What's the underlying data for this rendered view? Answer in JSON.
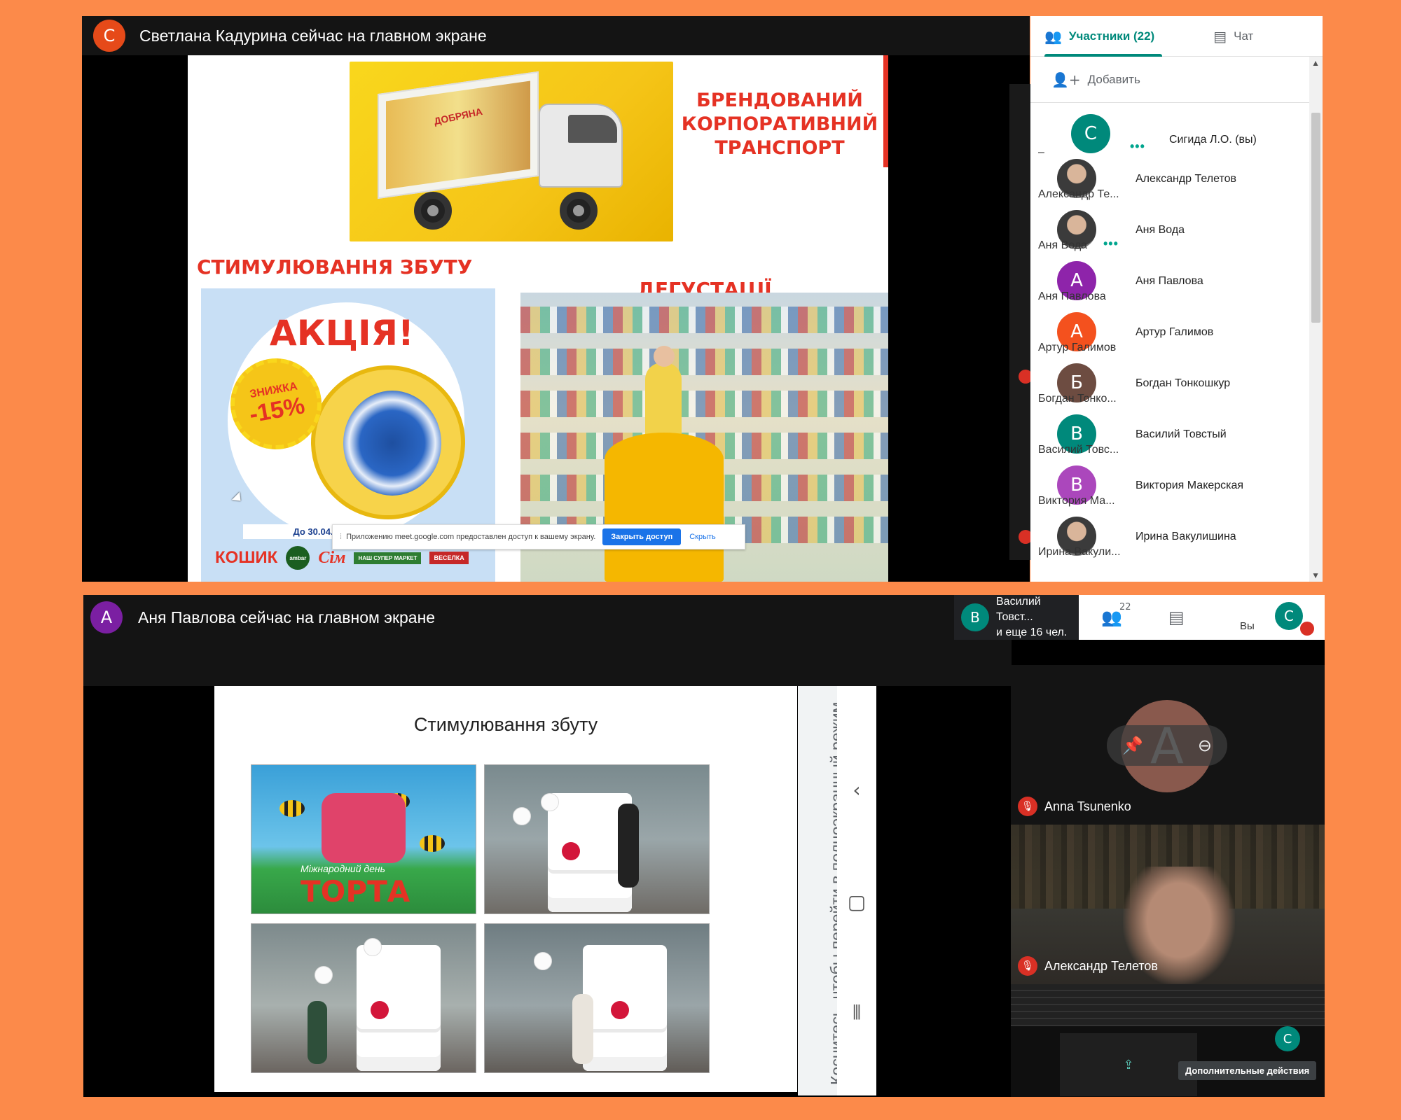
{
  "colors": {
    "page_bg": "#FC8A4A",
    "teal": "#00897B",
    "red": "#E53224",
    "mic_red": "#d93025",
    "link_blue": "#1a73e8"
  },
  "top": {
    "presenter_initial": "С",
    "presenter_color": "#E64A19",
    "banner": "Светлана Кадурина сейчас на главном экране",
    "slide": {
      "truck_logo": "ДОБРЯНА",
      "brand_title_1": "БРЕНДОВАНИЙ",
      "brand_title_2": "КОРПОРАТИВНИЙ",
      "brand_title_3": "ТРАНСПОРТ",
      "heading_promo": "СТИМУЛЮВАННЯ ЗБУТУ",
      "heading_tasting": "ДЕГУСТАЦІЇ",
      "promo_title": "АКЦІЯ!",
      "discount_label": "ЗНИЖКА",
      "discount_value": "-15%",
      "promo_until": "До 30.04.",
      "stores": [
        "КОШИК",
        "ambar",
        "Сім",
        "НАШ СУПЕР МАРКЕТ",
        "ВЕСЕЛКА"
      ]
    },
    "screen_share_notice": {
      "text": "Приложению meet.google.com предоставлен доступ к вашему экрану.",
      "stop_label": "Закрыть доступ",
      "hide_label": "Скрыть"
    }
  },
  "sidebar": {
    "tab_people": "Участники (22)",
    "tab_chat": "Чат",
    "add_label": "Добавить",
    "participants": [
      {
        "initial": "С",
        "color": "#00897B",
        "tile_label": "–",
        "name": "Сигида Л.О. (вы)",
        "photo": false,
        "dots": true
      },
      {
        "initial": "",
        "color": "",
        "tile_label": "Александр Те...",
        "name": "Александр Телетов",
        "photo": true,
        "dots": false
      },
      {
        "initial": "",
        "color": "",
        "tile_label": "Аня Вода",
        "name": "Аня Вода",
        "photo": true,
        "dots": true
      },
      {
        "initial": "А",
        "color": "#8E24AA",
        "tile_label": "Аня Павлова",
        "name": "Аня Павлова",
        "photo": false,
        "dots": false
      },
      {
        "initial": "А",
        "color": "#F4511E",
        "tile_label": "Артур Галимов",
        "name": "Артур Галимов",
        "photo": false,
        "dots": false
      },
      {
        "initial": "Б",
        "color": "#6D4C41",
        "tile_label": "Богдан Тонко...",
        "name": "Богдан Тонкошкур",
        "photo": false,
        "dots": false
      },
      {
        "initial": "В",
        "color": "#00897B",
        "tile_label": "Василий Товс...",
        "name": "Василий Товстый",
        "photo": false,
        "dots": false
      },
      {
        "initial": "В",
        "color": "#AB47BC",
        "tile_label": "Виктория Ма...",
        "name": "Виктория Макерская",
        "photo": false,
        "dots": false
      },
      {
        "initial": "",
        "color": "",
        "tile_label": "Ирина Вакули...",
        "name": "Ирина Вакулишина",
        "photo": true,
        "dots": false
      }
    ]
  },
  "bottom": {
    "presenter_initial": "А",
    "presenter_color": "#7B1FA2",
    "banner": "Аня Павлова сейчас на главном экране",
    "slide_title": "Стимулювання збуту",
    "cake_sign_1": "Міжнародний день",
    "cake_sign_2": "ТОРТА",
    "fullscreen_hint": "Коснитесь, чтобы перейти в полноэкранный режим",
    "speaker_initial": "В",
    "speaker_color": "#00897B",
    "speaker_line1": "Василий Товст...",
    "speaker_line2": "и еще 16 чел.",
    "people_count": "22",
    "you_label": "Вы",
    "you_initial": "С",
    "tile1_name": "Anna Tsunenko",
    "tile1_initial": "A",
    "tile2_name": "Александр Телетов",
    "more_actions": "Дополнительные действия",
    "tile3_initial": "С"
  }
}
